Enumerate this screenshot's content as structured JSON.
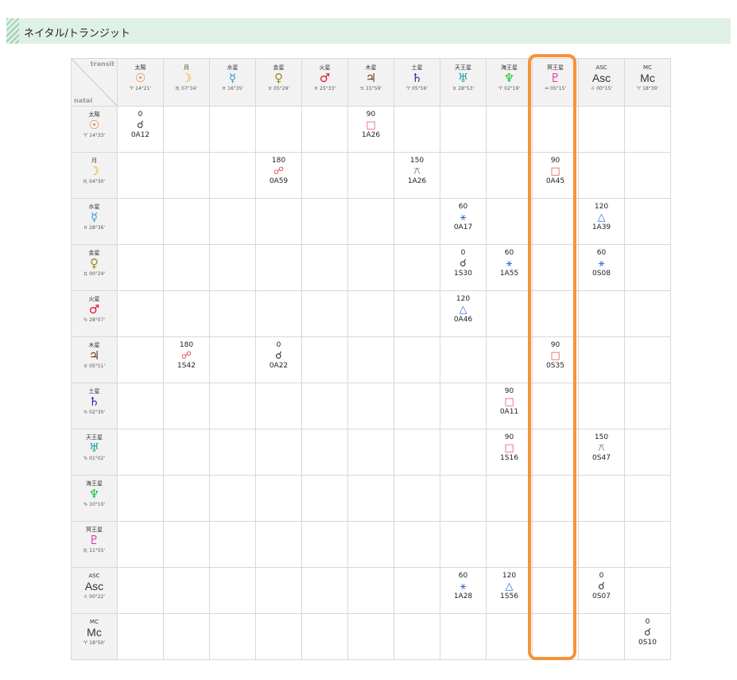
{
  "header": {
    "title": "ネイタル/トランジット"
  },
  "corner": {
    "transit_label": "transit",
    "natal_label": "natal"
  },
  "transit": [
    {
      "name": "太陽",
      "symbol": "☉",
      "pos": "♈ 14°21'",
      "cls": "c-sun"
    },
    {
      "name": "月",
      "symbol": "☽",
      "pos": "♏ 07°34'",
      "cls": "c-moon"
    },
    {
      "name": "水星",
      "symbol": "☿",
      "pos": "♓ 16°35'",
      "cls": "c-mercury"
    },
    {
      "name": "金星",
      "symbol": "♀",
      "pos": "♉ 05°29'",
      "cls": "c-venus"
    },
    {
      "name": "火星",
      "symbol": "♂",
      "pos": "♓ 25°33'",
      "cls": "c-mars"
    },
    {
      "name": "木星",
      "symbol": "♃",
      "pos": "♋ 15°59'",
      "cls": "c-jupiter"
    },
    {
      "name": "土星",
      "symbol": "♄",
      "pos": "♈ 05°56'",
      "cls": "c-saturn"
    },
    {
      "name": "天王星",
      "symbol": "♅",
      "pos": "♉ 28°53'",
      "cls": "c-uranus"
    },
    {
      "name": "海王星",
      "symbol": "♆",
      "pos": "♈ 02°19'",
      "cls": "c-neptune"
    },
    {
      "name": "冥王星",
      "symbol": "♇",
      "pos": "♒ 05°15'",
      "cls": "c-pluto"
    },
    {
      "name": "ASC",
      "symbol": "Asc",
      "pos": "♌ 00°15'",
      "cls": "c-asc",
      "txt": true
    },
    {
      "name": "MC",
      "symbol": "Mc",
      "pos": "♈ 18°39'",
      "cls": "c-mc",
      "txt": true
    }
  ],
  "natal": [
    {
      "name": "太陽",
      "symbol": "☉",
      "pos": "♈ 14°33'",
      "cls": "c-sun"
    },
    {
      "name": "月",
      "symbol": "☽",
      "pos": "♏ 04°30'",
      "cls": "c-moon"
    },
    {
      "name": "水星",
      "symbol": "☿",
      "pos": "♓ 28°36'",
      "cls": "c-mercury"
    },
    {
      "name": "金星",
      "symbol": "♀",
      "pos": "♊ 00°24'",
      "cls": "c-venus"
    },
    {
      "name": "火星",
      "symbol": "♂",
      "pos": "♑ 28°07'",
      "cls": "c-mars"
    },
    {
      "name": "木星",
      "symbol": "♃",
      "pos": "♉ 05°51'",
      "cls": "c-jupiter"
    },
    {
      "name": "土星",
      "symbol": "♄",
      "pos": "♑ 02°30'",
      "cls": "c-saturn"
    },
    {
      "name": "天王星",
      "symbol": "♅",
      "pos": "♑ 01°02'",
      "cls": "c-uranus"
    },
    {
      "name": "海王星",
      "symbol": "♆",
      "pos": "♑ 10°10'",
      "cls": "c-neptune"
    },
    {
      "name": "冥王星",
      "symbol": "♇",
      "pos": "♏ 11°55'",
      "cls": "c-pluto"
    },
    {
      "name": "ASC",
      "symbol": "Asc",
      "pos": "♌ 00°22'",
      "cls": "c-asc",
      "txt": true
    },
    {
      "name": "MC",
      "symbol": "Mc",
      "pos": "♈ 18°50'",
      "cls": "c-mc",
      "txt": true
    }
  ],
  "aspects": [
    {
      "row": 0,
      "col": 0,
      "deg": "0",
      "symbol": "☌",
      "orb": "0A12",
      "type": "a-conj"
    },
    {
      "row": 0,
      "col": 5,
      "deg": "90",
      "symbol": "□",
      "orb": "1A26",
      "type": "a-square"
    },
    {
      "row": 1,
      "col": 3,
      "deg": "180",
      "symbol": "☍",
      "orb": "0A59",
      "type": "a-opp"
    },
    {
      "row": 1,
      "col": 6,
      "deg": "150",
      "symbol": "⚻",
      "orb": "1A26",
      "type": "a-quin"
    },
    {
      "row": 1,
      "col": 9,
      "deg": "90",
      "symbol": "□",
      "orb": "0A45",
      "type": "a-square"
    },
    {
      "row": 2,
      "col": 7,
      "deg": "60",
      "symbol": "⚹",
      "orb": "0A17",
      "type": "a-sext"
    },
    {
      "row": 2,
      "col": 10,
      "deg": "120",
      "symbol": "△",
      "orb": "1A39",
      "type": "a-trine"
    },
    {
      "row": 3,
      "col": 7,
      "deg": "0",
      "symbol": "☌",
      "orb": "1S30",
      "type": "a-conj"
    },
    {
      "row": 3,
      "col": 8,
      "deg": "60",
      "symbol": "⚹",
      "orb": "1A55",
      "type": "a-sext"
    },
    {
      "row": 3,
      "col": 10,
      "deg": "60",
      "symbol": "⚹",
      "orb": "0S08",
      "type": "a-sext"
    },
    {
      "row": 4,
      "col": 7,
      "deg": "120",
      "symbol": "△",
      "orb": "0A46",
      "type": "a-trine"
    },
    {
      "row": 5,
      "col": 1,
      "deg": "180",
      "symbol": "☍",
      "orb": "1S42",
      "type": "a-opp"
    },
    {
      "row": 5,
      "col": 3,
      "deg": "0",
      "symbol": "☌",
      "orb": "0A22",
      "type": "a-conj"
    },
    {
      "row": 5,
      "col": 9,
      "deg": "90",
      "symbol": "□",
      "orb": "0S35",
      "type": "a-square"
    },
    {
      "row": 6,
      "col": 8,
      "deg": "90",
      "symbol": "□",
      "orb": "0A11",
      "type": "a-square"
    },
    {
      "row": 7,
      "col": 8,
      "deg": "90",
      "symbol": "□",
      "orb": "1S16",
      "type": "a-square"
    },
    {
      "row": 7,
      "col": 10,
      "deg": "150",
      "symbol": "⚻",
      "orb": "0S47",
      "type": "a-quin"
    },
    {
      "row": 10,
      "col": 7,
      "deg": "60",
      "symbol": "⚹",
      "orb": "1A28",
      "type": "a-sext"
    },
    {
      "row": 10,
      "col": 8,
      "deg": "120",
      "symbol": "△",
      "orb": "1S56",
      "type": "a-trine"
    },
    {
      "row": 10,
      "col": 10,
      "deg": "0",
      "symbol": "☌",
      "orb": "0S07",
      "type": "a-conj"
    },
    {
      "row": 11,
      "col": 11,
      "deg": "0",
      "symbol": "☌",
      "orb": "0S10",
      "type": "a-conj"
    }
  ],
  "highlight": {
    "column": 9,
    "color": "#f7913a"
  }
}
